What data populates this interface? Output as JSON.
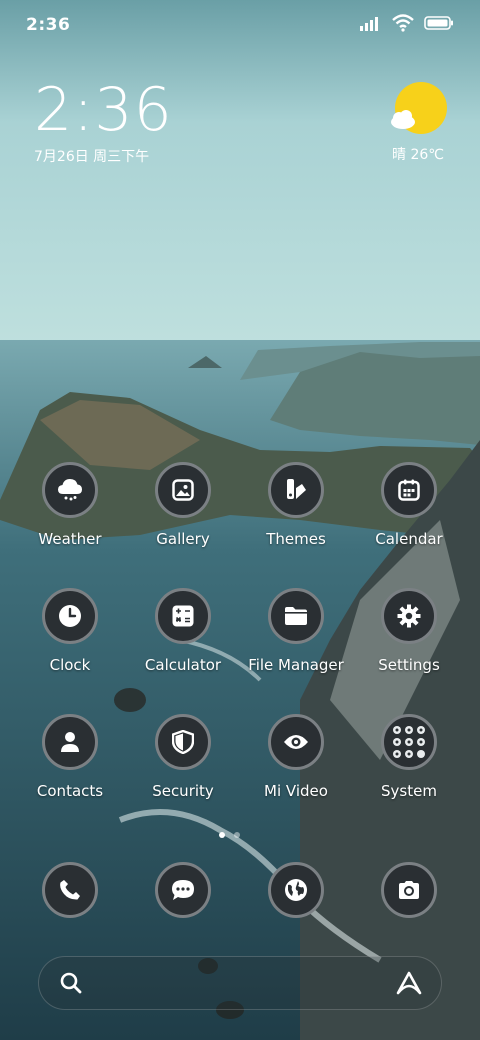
{
  "status_bar": {
    "time": "2:36",
    "icons": [
      "signal-icon",
      "wifi-icon",
      "battery-icon"
    ]
  },
  "clock_widget": {
    "time": "2:36",
    "date": "7月26日 周三下午"
  },
  "weather_widget": {
    "icon": "sun-cloud-icon",
    "condition_temp": "晴 26℃"
  },
  "apps": [
    {
      "label": "Weather",
      "icon": "weather-cloud-icon"
    },
    {
      "label": "Gallery",
      "icon": "gallery-icon"
    },
    {
      "label": "Themes",
      "icon": "themes-icon"
    },
    {
      "label": "Calendar",
      "icon": "calendar-icon"
    },
    {
      "label": "Clock",
      "icon": "clock-icon"
    },
    {
      "label": "Calculator",
      "icon": "calculator-icon"
    },
    {
      "label": "File Manager",
      "icon": "folder-icon"
    },
    {
      "label": "Settings",
      "icon": "gear-icon"
    },
    {
      "label": "Contacts",
      "icon": "person-icon"
    },
    {
      "label": "Security",
      "icon": "shield-icon"
    },
    {
      "label": "Mi Video",
      "icon": "eye-icon"
    },
    {
      "label": "System",
      "icon": "folder-grid-icon"
    }
  ],
  "page_indicator": {
    "pages": 2,
    "current": 1
  },
  "dock": [
    {
      "icon": "phone-icon"
    },
    {
      "icon": "message-icon"
    },
    {
      "icon": "browser-globe-icon"
    },
    {
      "icon": "camera-icon"
    }
  ],
  "search_bar": {
    "left_icon": "search-icon",
    "right_icon": "assistant-icon"
  },
  "colors": {
    "icon_bg": "#2a2f33",
    "icon_ring": "#7b8084",
    "sun": "#f7d11a"
  }
}
